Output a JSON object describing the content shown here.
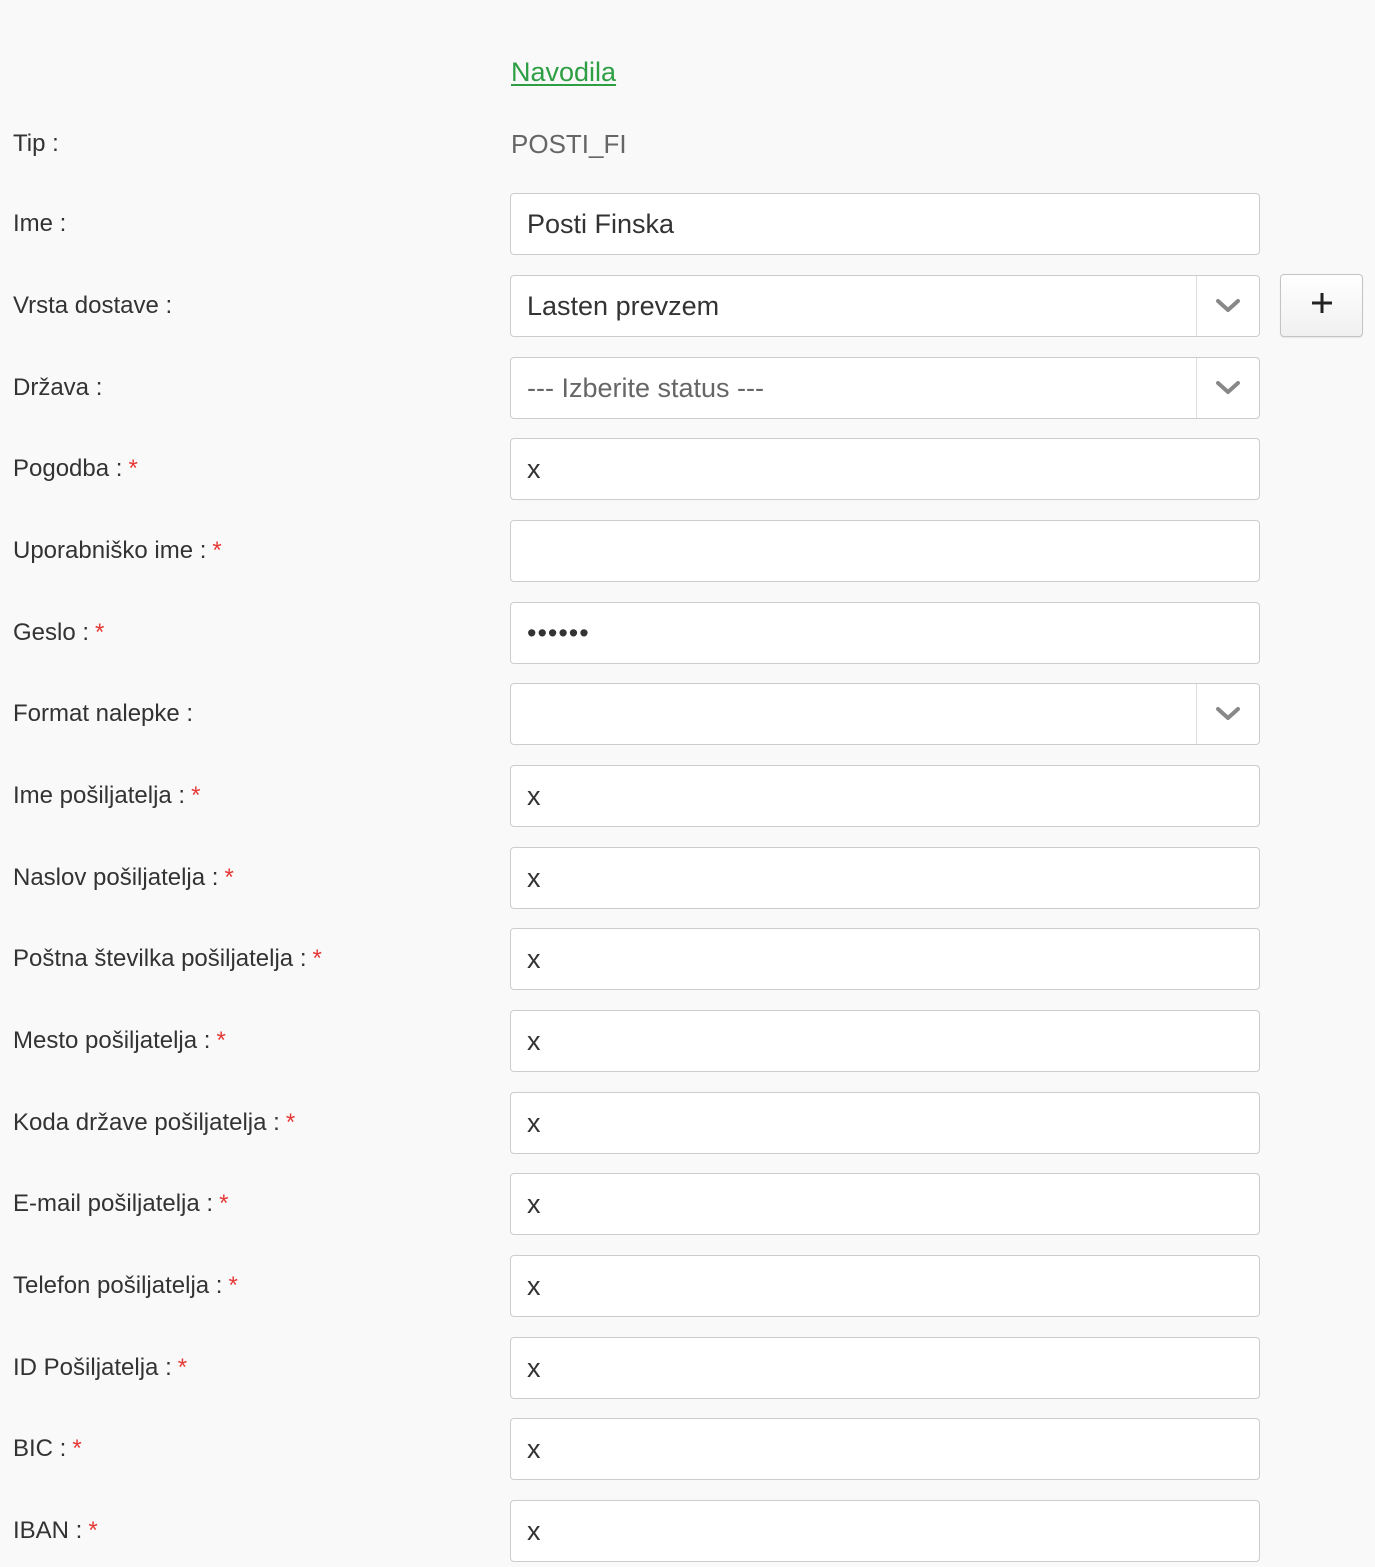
{
  "header": {
    "instructions_link": "Navodila"
  },
  "form": {
    "tip": {
      "label": "Tip :",
      "value": "POSTI_FI"
    },
    "ime": {
      "label": "Ime :",
      "value": "Posti Finska"
    },
    "vrsta_dostave": {
      "label": "Vrsta dostave :",
      "selected": "Lasten prevzem",
      "add_icon": "plus-icon"
    },
    "drzava": {
      "label": "Država :",
      "placeholder": "--- Izberite status ---"
    },
    "pogodba": {
      "label": "Pogodba :",
      "required_mark": "*",
      "value": "x"
    },
    "uporabnisko_ime": {
      "label": "Uporabniško ime :",
      "required_mark": "*",
      "value": ""
    },
    "geslo": {
      "label": "Geslo :",
      "required_mark": "*",
      "value": "xxxxxx"
    },
    "format_nalepke": {
      "label": "Format nalepke :",
      "selected": ""
    },
    "ime_posiljatelja": {
      "label": "Ime pošiljatelja :",
      "required_mark": "*",
      "value": "x"
    },
    "naslov_posiljatelja": {
      "label": "Naslov pošiljatelja :",
      "required_mark": "*",
      "value": "x"
    },
    "postna_stevilka": {
      "label": "Poštna številka pošiljatelja :",
      "required_mark": "*",
      "value": "x"
    },
    "mesto_posiljatelja": {
      "label": "Mesto pošiljatelja :",
      "required_mark": "*",
      "value": "x"
    },
    "koda_drzave": {
      "label": "Koda države pošiljatelja :",
      "required_mark": "*",
      "value": "x"
    },
    "email_posiljatelja": {
      "label": "E-mail pošiljatelja :",
      "required_mark": "*",
      "value": "x"
    },
    "telefon_posiljatelja": {
      "label": "Telefon pošiljatelja :",
      "required_mark": "*",
      "value": "x"
    },
    "id_posiljatelja": {
      "label": "ID Pošiljatelja :",
      "required_mark": "*",
      "value": "x"
    },
    "bic": {
      "label": "BIC :",
      "required_mark": "*",
      "value": "x"
    },
    "iban": {
      "label": "IBAN :",
      "required_mark": "*",
      "value": "x"
    }
  },
  "icons": {
    "select_arrow": "chevron-down-icon"
  },
  "colors": {
    "link": "#2e9e44",
    "required": "#e53935",
    "background": "#f9f9f9",
    "border": "#cccccc"
  }
}
